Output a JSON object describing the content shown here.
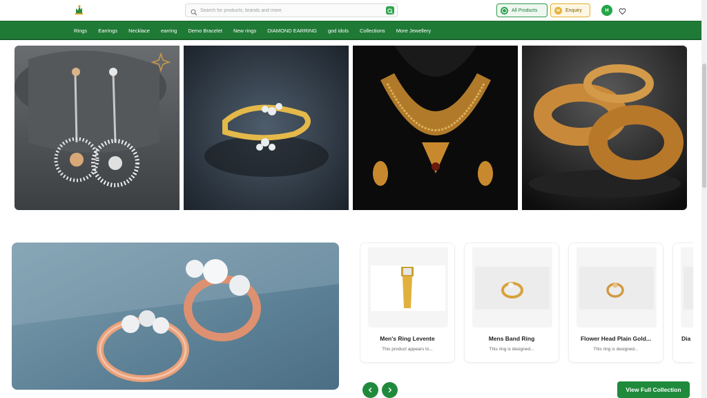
{
  "header": {
    "logo_name": "brand-logo",
    "search": {
      "placeholder": "Search for products, brands and more",
      "value": ""
    },
    "all_products_label": "All Products",
    "enquiry_label": "Enquiry",
    "avatar_initial": "H"
  },
  "nav": {
    "items": [
      {
        "label": "Rings"
      },
      {
        "label": "Earrings"
      },
      {
        "label": "Necklace"
      },
      {
        "label": "earring"
      },
      {
        "label": "Demo Bracelet"
      },
      {
        "label": "New rings"
      },
      {
        "label": "DIAMOND EARRING"
      },
      {
        "label": "god idols"
      },
      {
        "label": "Collections"
      },
      {
        "label": "More Jewellery"
      }
    ]
  },
  "products": [
    {
      "title": "Men's Ring Levente",
      "desc": "This product appears to..."
    },
    {
      "title": "Mens Band Ring",
      "desc": "This ring is designed..."
    },
    {
      "title": "Flower Head Plain Gold...",
      "desc": "This ring is designed..."
    },
    {
      "title": "Dia",
      "desc": ""
    }
  ],
  "collection_cta_label": "View Full Collection",
  "colors": {
    "brand_green": "#1f7a36",
    "accent_green": "#1f8a3c",
    "enquiry_gold": "#e6b23a"
  },
  "icons": [
    "search-icon",
    "whatsapp-icon",
    "enquiry-icon",
    "heart-icon",
    "chevron-left-icon",
    "chevron-right-icon"
  ]
}
